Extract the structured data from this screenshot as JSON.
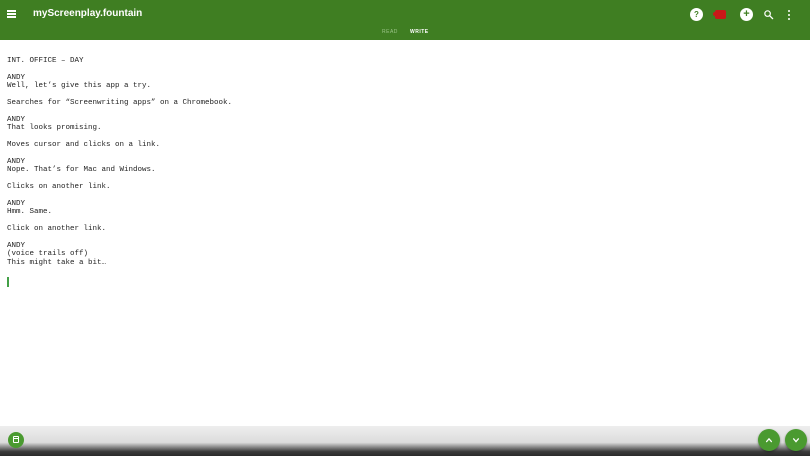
{
  "app": {
    "title": "myScreenplay.fountain"
  },
  "toolbar": {
    "icons": [
      "menu-icon",
      "help-icon",
      "record-icon",
      "add-icon",
      "search-icon",
      "more-vert-icon"
    ],
    "help_glyph": "?",
    "add_glyph": "+"
  },
  "tabs": [
    {
      "label": "READ",
      "active": false
    },
    {
      "label": "WRITE",
      "active": true
    }
  ],
  "script": {
    "lines": [
      "INT. OFFICE – DAY",
      "ANDY",
      "Well, let’s give this app a try.",
      "Searches for “Screenwriting apps” on a Chromebook.",
      "ANDY",
      "That looks promising.",
      "Moves cursor and clicks on a link.",
      "ANDY",
      "Nope. That’s for Mac and Windows.",
      "Clicks on another link.",
      "ANDY",
      "Hmm. Same.",
      "Click on another link.",
      "ANDY",
      "(voice trails off)",
      "This might take a bit…"
    ]
  },
  "colors": {
    "appbar": "#3f7e22",
    "accent": "#4a9a30",
    "caret": "#43a047",
    "record": "#c81818"
  },
  "bottom": {
    "icons": [
      "outline-icon",
      "scroll-up-icon",
      "scroll-down-icon"
    ]
  }
}
